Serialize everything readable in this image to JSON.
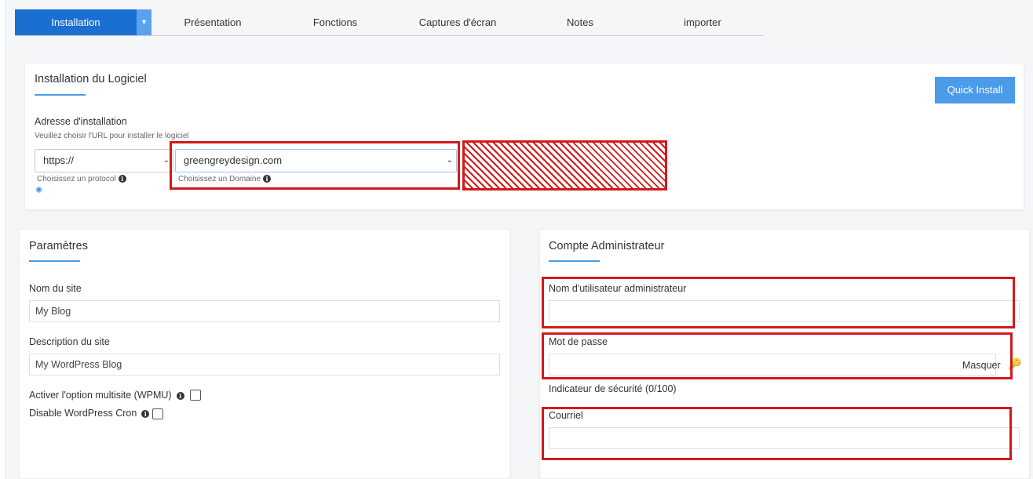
{
  "tabs": {
    "installation": "Installation",
    "presentation": "Présentation",
    "fonctions": "Fonctions",
    "captures": "Captures d'écran",
    "notes": "Notes",
    "importer": "importer"
  },
  "install_card": {
    "title": "Installation du Logiciel",
    "quick_install": "Quick Install",
    "address_label": "Adresse d'installation",
    "address_help": "Veuillez choisir l'URL pour installer le logiciel",
    "protocol_value": "https://",
    "protocol_help": "Choisissez un protocol",
    "domain_value": "greengreydesign.com",
    "domain_help": "Choisissez un Domaine"
  },
  "params_card": {
    "title": "Paramètres",
    "site_name_label": "Nom du site",
    "site_name_value": "My Blog",
    "site_desc_label": "Description du site",
    "site_desc_value": "My WordPress Blog",
    "multisite_label": "Activer l'option multisite (WPMU)",
    "cron_label": "Disable WordPress Cron"
  },
  "admin_card": {
    "title": "Compte Administrateur",
    "username_label": "Nom d'utilisateur administrateur",
    "username_value": "",
    "password_label": "Mot de passe",
    "password_value": "",
    "hide_label": "Masquer",
    "strength_label": "Indicateur de sécurité (0/100)",
    "email_label": "Courriel",
    "email_value": ""
  },
  "icons": {
    "info": "info-icon",
    "spinner": "spinner-icon",
    "key": "key-icon",
    "caret": "chevron-down-icon"
  },
  "colors": {
    "accent": "#1a6fd1",
    "accent_light": "#4a9be8",
    "highlight": "#d11a1a"
  }
}
